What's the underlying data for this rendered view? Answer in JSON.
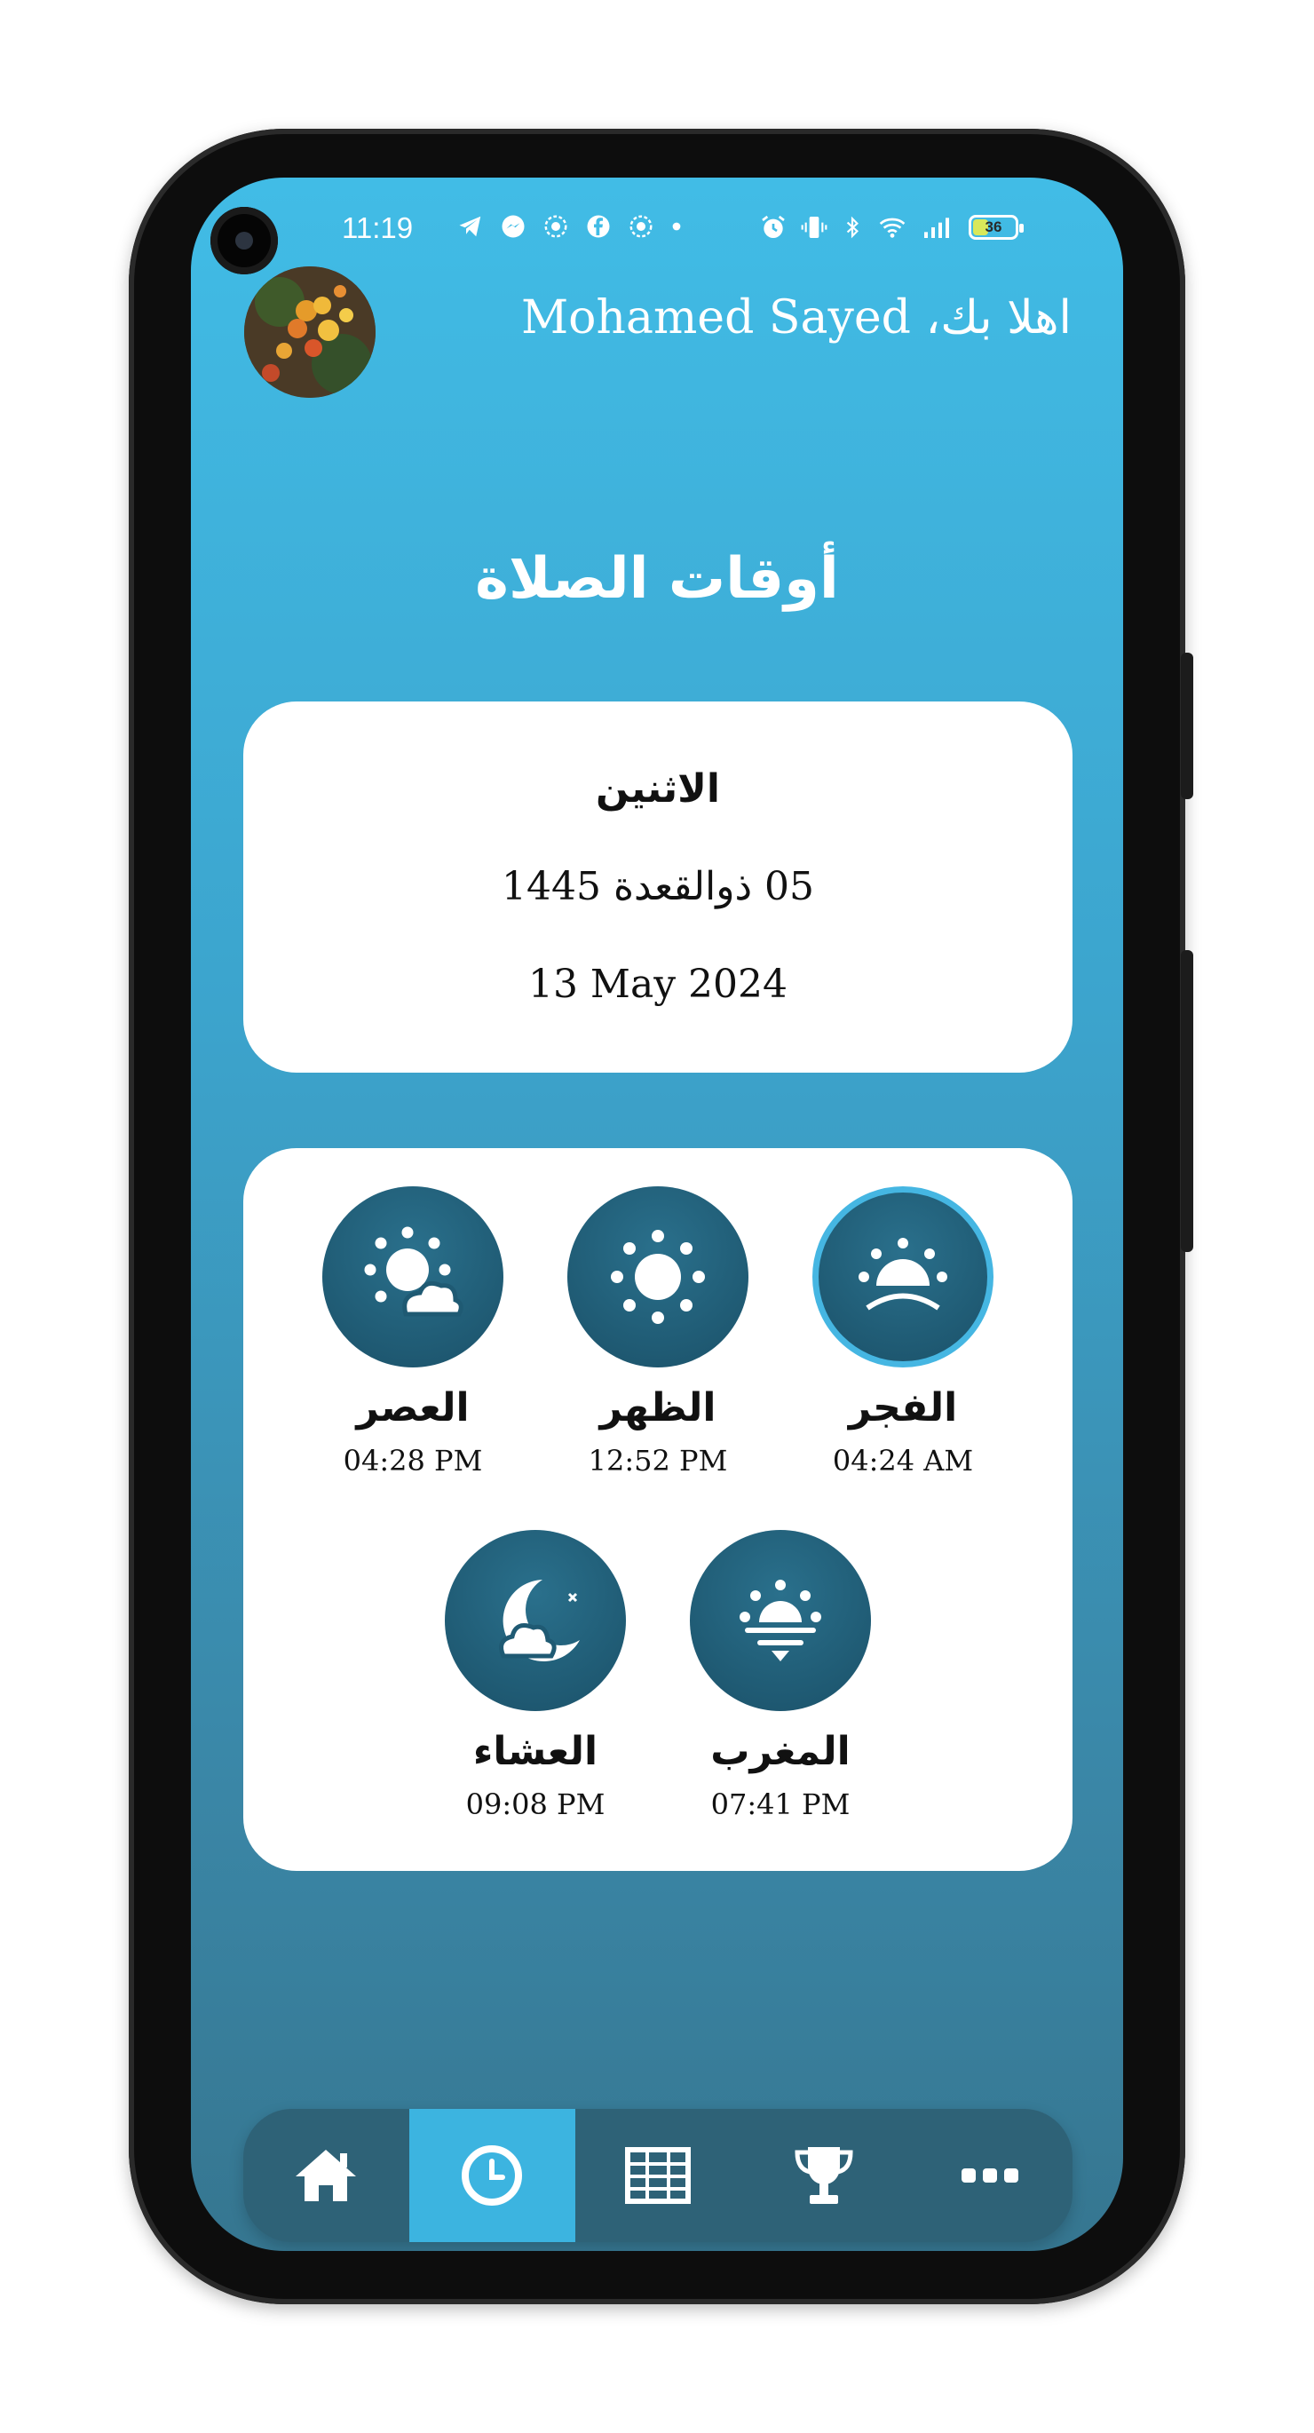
{
  "status_bar": {
    "time": "11:19",
    "battery_level": "36",
    "icons_left": [
      "telegram-icon",
      "messenger-icon",
      "app-icon",
      "facebook-icon",
      "app-icon",
      "dot-icon"
    ],
    "icons_right": [
      "alarm-icon",
      "vibrate-icon",
      "bluetooth-icon",
      "wifi-icon",
      "signal-icon",
      "battery-icon"
    ]
  },
  "header": {
    "greeting": "اهلا بك، Mohamed Sayed"
  },
  "page": {
    "title": "أوقات الصلاة"
  },
  "date_card": {
    "day": "الاثنين",
    "hijri": "05 ذوالقعدة 1445",
    "gregorian": "13 May 2024"
  },
  "prayers": [
    {
      "name": "الفجر",
      "time": "04:24 AM",
      "icon": "sunrise-icon",
      "active": true
    },
    {
      "name": "الظهر",
      "time": "12:52 PM",
      "icon": "sun-icon",
      "active": false
    },
    {
      "name": "العصر",
      "time": "04:28 PM",
      "icon": "sun-cloud-icon",
      "active": false
    },
    {
      "name": "المغرب",
      "time": "07:41 PM",
      "icon": "sunset-icon",
      "active": false
    },
    {
      "name": "العشاء",
      "time": "09:08 PM",
      "icon": "moon-cloud-icon",
      "active": false
    }
  ],
  "bottom_nav": {
    "items": [
      "home-icon",
      "clock-icon",
      "grid-icon",
      "trophy-icon",
      "more-icon"
    ],
    "active_index": 1
  },
  "colors": {
    "accent": "#3cb4e0",
    "icon_bg": "#1f5a73",
    "nav_bg": "#2e6277"
  }
}
